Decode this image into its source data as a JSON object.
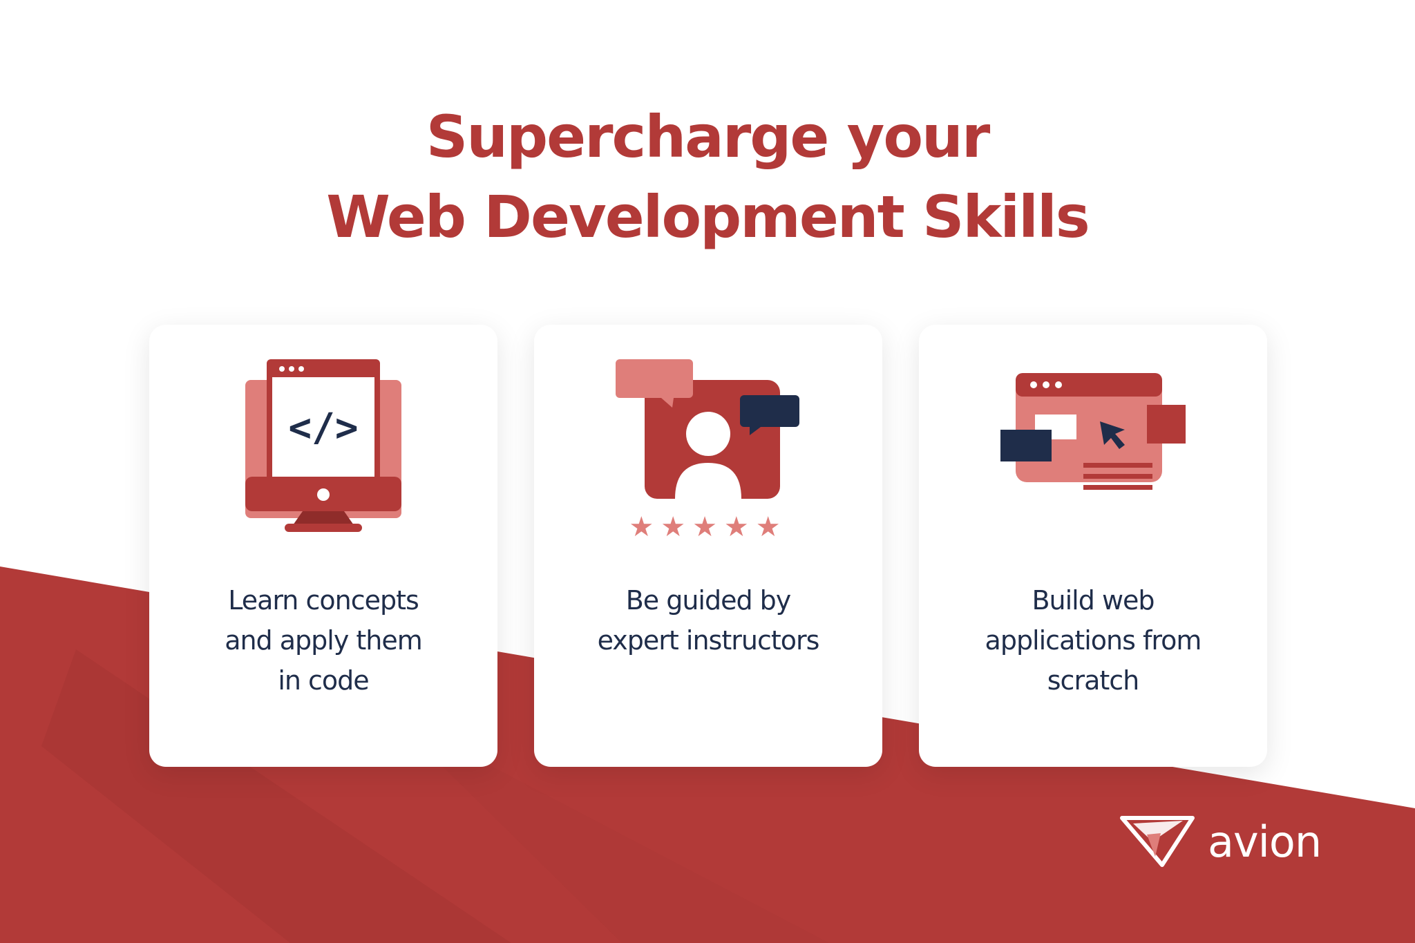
{
  "headline": {
    "line1": "Supercharge your",
    "line2": "Web Development Skills"
  },
  "cards": [
    {
      "icon": "code-monitor-icon",
      "lines": [
        "Learn concepts",
        "and apply them",
        "in code"
      ]
    },
    {
      "icon": "instructor-chat-icon",
      "rating_stars": 5,
      "lines": [
        "Be guided by",
        "expert instructors"
      ]
    },
    {
      "icon": "web-app-builder-icon",
      "lines": [
        "Build web",
        "applications from",
        "scratch"
      ]
    }
  ],
  "brand": {
    "name": "avion",
    "icon": "paper-plane-icon"
  },
  "colors": {
    "primary_red": "#b23a38",
    "light_red": "#df7e7a",
    "navy": "#1f2d4a",
    "white": "#ffffff"
  }
}
